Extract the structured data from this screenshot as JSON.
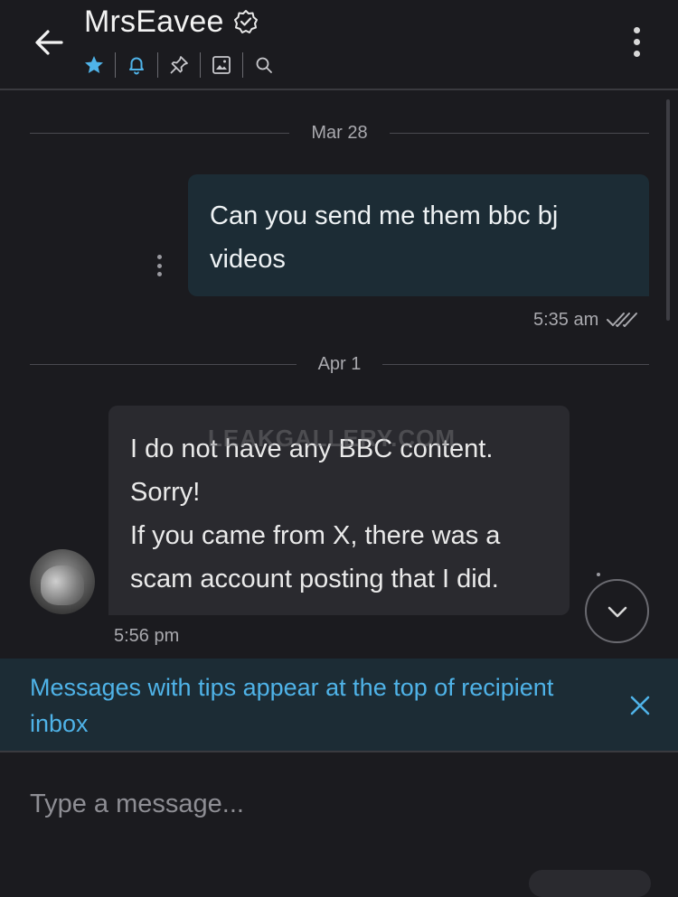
{
  "header": {
    "title": "MrsEavee",
    "icons": [
      "back-arrow-icon",
      "verified-badge-icon",
      "star-icon",
      "bell-icon",
      "pin-icon",
      "image-icon",
      "search-icon",
      "more-vertical-icon"
    ]
  },
  "colors": {
    "accent": "#4fb3e8",
    "background": "#1b1b1f",
    "outgoing_bubble": "#1c2c35",
    "incoming_bubble": "#2a2a2f"
  },
  "conversation": {
    "date_1": "Mar 28",
    "outgoing_message": {
      "line_1": "Can you send me them bbc bj",
      "line_2": "videos",
      "time": "5:35 am"
    },
    "date_2": "Apr 1",
    "incoming_message": {
      "line_1": "I do not have any BBC content.",
      "line_2": "Sorry!",
      "line_3": "If you came from X, there was a",
      "line_4": "scam account posting that I did.",
      "time": "5:56 pm",
      "watermark": "LEAKGALLERY.COM"
    }
  },
  "tip_banner": {
    "line_1": "Messages with tips appear at the top of recipient",
    "line_2": "inbox"
  },
  "composer": {
    "placeholder": "Type a message..."
  }
}
